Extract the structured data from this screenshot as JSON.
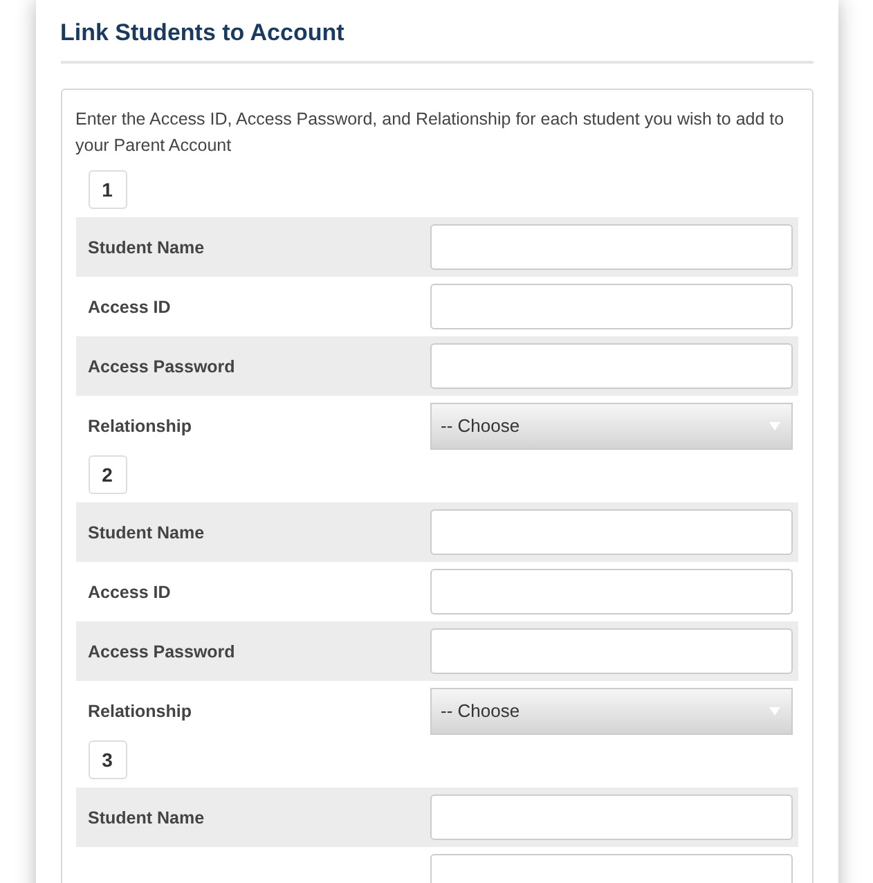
{
  "title": "Link Students to Account",
  "intro": "Enter the Access ID, Access Password, and Relationship for each student you wish to add to your Parent Account",
  "students": [
    {
      "number": "1",
      "fields": [
        {
          "label": "Student Name",
          "kind": "text"
        },
        {
          "label": "Access ID",
          "kind": "text"
        },
        {
          "label": "Access Password",
          "kind": "text"
        },
        {
          "label": "Relationship",
          "kind": "select",
          "value": "-- Choose"
        }
      ]
    },
    {
      "number": "2",
      "fields": [
        {
          "label": "Student Name",
          "kind": "text"
        },
        {
          "label": "Access ID",
          "kind": "text"
        },
        {
          "label": "Access Password",
          "kind": "text"
        },
        {
          "label": "Relationship",
          "kind": "select",
          "value": "-- Choose"
        }
      ]
    },
    {
      "number": "3",
      "fields": [
        {
          "label": "Student Name",
          "kind": "text"
        },
        {
          "kind": "text"
        }
      ]
    }
  ]
}
